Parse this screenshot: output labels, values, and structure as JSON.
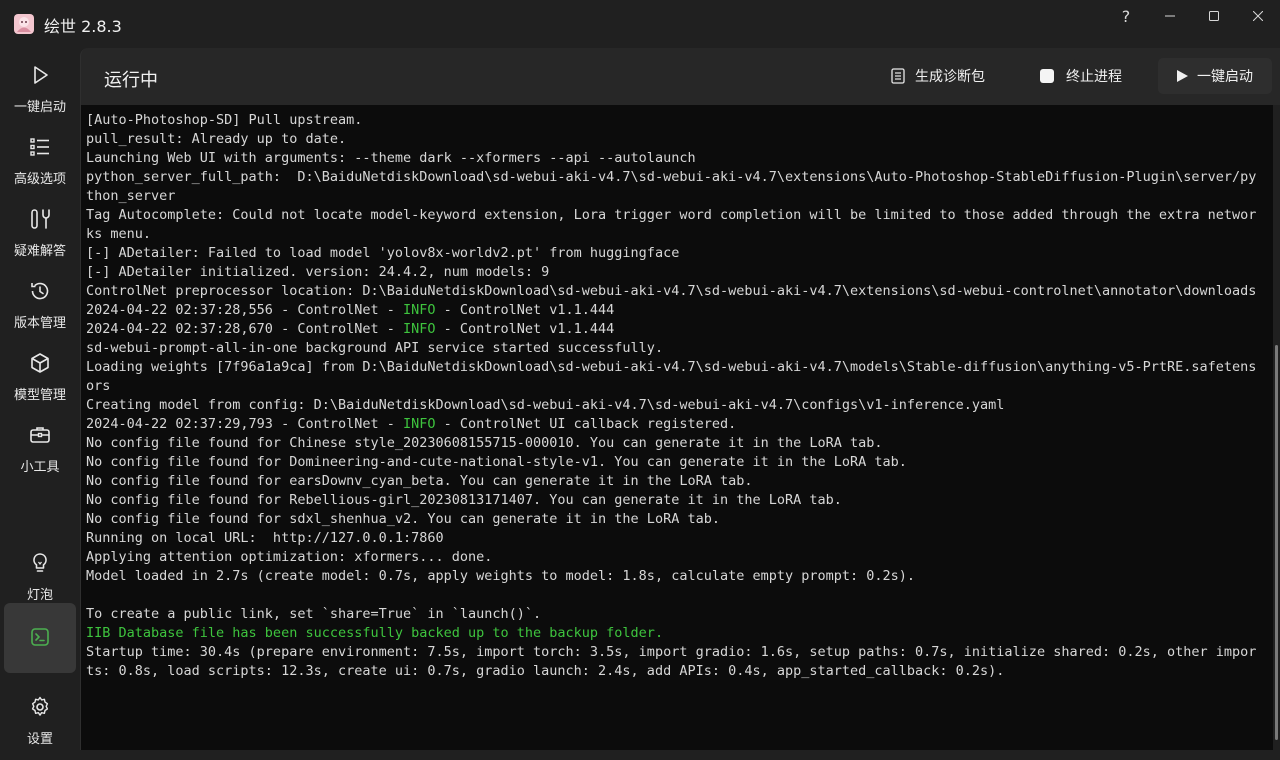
{
  "app": {
    "title": "绘世 2.8.3"
  },
  "window_controls": {
    "help": "?"
  },
  "sidebar": {
    "items": [
      {
        "label": "一键启动",
        "icon": "play-icon"
      },
      {
        "label": "高级选项",
        "icon": "list-icon"
      },
      {
        "label": "疑难解答",
        "icon": "tools-icon"
      },
      {
        "label": "版本管理",
        "icon": "history-icon"
      },
      {
        "label": "模型管理",
        "icon": "cube-icon"
      },
      {
        "label": "小工具",
        "icon": "toolbox-icon"
      },
      {
        "label": "灯泡",
        "icon": "lightbulb-icon"
      },
      {
        "label": "",
        "icon": "console-icon",
        "active": true
      },
      {
        "label": "设置",
        "icon": "gear-icon"
      }
    ]
  },
  "header": {
    "title": "运行中",
    "diagnose_label": "生成诊断包",
    "kill_label": "终止进程",
    "launch_label": "一键启动"
  },
  "colors": {
    "accent_green": "#3ec43e",
    "console_bg": "#0c0c0c",
    "panel_bg": "#272727"
  },
  "console": {
    "lines": [
      "[Auto-Photoshop-SD] Pull upstream.",
      "pull_result: Already up to date.",
      "Launching Web UI with arguments: --theme dark --xformers --api --autolaunch",
      "python_server_full_path:  D:\\BaiduNetdiskDownload\\sd-webui-aki-v4.7\\sd-webui-aki-v4.7\\extensions\\Auto-Photoshop-StableDiffusion-Plugin\\server/python_server",
      "Tag Autocomplete: Could not locate model-keyword extension, Lora trigger word completion will be limited to those added through the extra networks menu.",
      "[-] ADetailer: Failed to load model 'yolov8x-worldv2.pt' from huggingface",
      "[-] ADetailer initialized. version: 24.4.2, num models: 9",
      "ControlNet preprocessor location: D:\\BaiduNetdiskDownload\\sd-webui-aki-v4.7\\sd-webui-aki-v4.7\\extensions\\sd-webui-controlnet\\annotator\\downloads",
      {
        "pre": "2024-04-22 02:37:28,556 - ControlNet - ",
        "info": "INFO",
        "post": " - ControlNet v1.1.444"
      },
      {
        "pre": "2024-04-22 02:37:28,670 - ControlNet - ",
        "info": "INFO",
        "post": " - ControlNet v1.1.444"
      },
      "sd-webui-prompt-all-in-one background API service started successfully.",
      "Loading weights [7f96a1a9ca] from D:\\BaiduNetdiskDownload\\sd-webui-aki-v4.7\\sd-webui-aki-v4.7\\models\\Stable-diffusion\\anything-v5-PrtRE.safetensors",
      "Creating model from config: D:\\BaiduNetdiskDownload\\sd-webui-aki-v4.7\\sd-webui-aki-v4.7\\configs\\v1-inference.yaml",
      {
        "pre": "2024-04-22 02:37:29,793 - ControlNet - ",
        "info": "INFO",
        "post": " - ControlNet UI callback registered."
      },
      "No config file found for Chinese style_20230608155715-000010. You can generate it in the LoRA tab.",
      "No config file found for Domineering-and-cute-national-style-v1. You can generate it in the LoRA tab.",
      "No config file found for earsDownv_cyan_beta. You can generate it in the LoRA tab.",
      "No config file found for Rebellious-girl_20230813171407. You can generate it in the LoRA tab.",
      "No config file found for sdxl_shenhua_v2. You can generate it in the LoRA tab.",
      "Running on local URL:  http://127.0.0.1:7860",
      "Applying attention optimization: xformers... done.",
      "Model loaded in 2.7s (create model: 0.7s, apply weights to model: 1.8s, calculate empty prompt: 0.2s).",
      "",
      "To create a public link, set `share=True` in `launch()`.",
      {
        "text": "IIB Database file has been successfully backed up to the backup folder.",
        "green": true
      },
      "Startup time: 30.4s (prepare environment: 7.5s, import torch: 3.5s, import gradio: 1.6s, setup paths: 0.7s, initialize shared: 0.2s, other imports: 0.8s, load scripts: 12.3s, create ui: 0.7s, gradio launch: 2.4s, add APIs: 0.4s, app_started_callback: 0.2s)."
    ]
  }
}
